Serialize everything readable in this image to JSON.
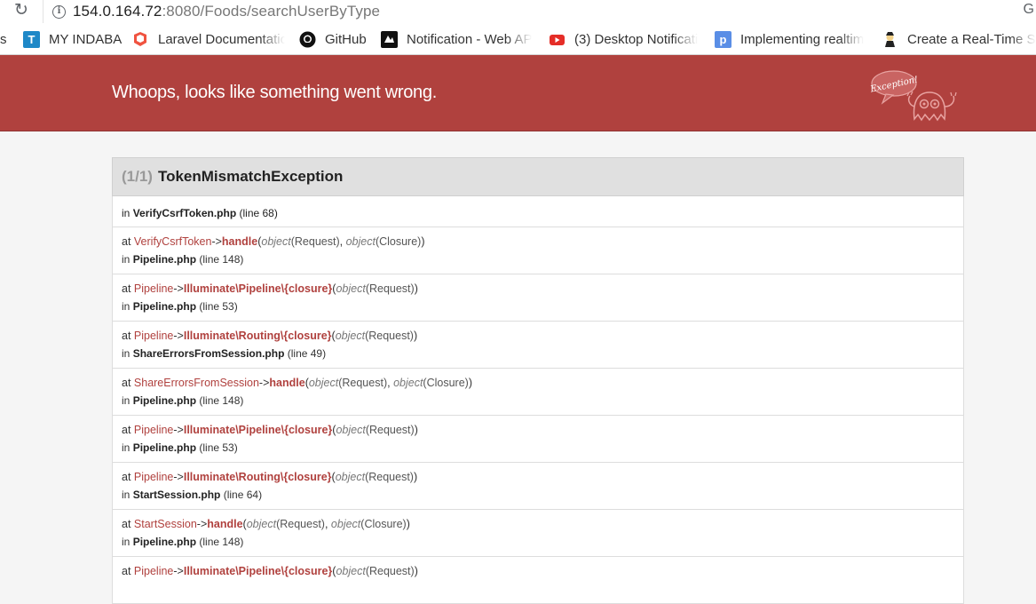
{
  "browser": {
    "url_host": "154.0.164.72",
    "url_path": ":8080/Foods/searchUserByType",
    "bookmarks": [
      {
        "label": "s",
        "icon": "bookmark-partial-icon"
      },
      {
        "label": "MY INDABA",
        "icon": "t-logo-icon"
      },
      {
        "label": "Laravel Documentatio",
        "icon": "laravel-icon"
      },
      {
        "label": "GitHub",
        "icon": "github-icon"
      },
      {
        "label": "Notification - Web AP",
        "icon": "mdn-icon"
      },
      {
        "label": "(3) Desktop Notificati",
        "icon": "youtube-icon"
      },
      {
        "label": "Implementing realtim",
        "icon": "p-logo-icon"
      },
      {
        "label": "Create a Real-Time Sh",
        "icon": "dev-avatar-icon"
      }
    ]
  },
  "header": {
    "title": "Whoops, looks like something went wrong.",
    "logo_text": "Exception!"
  },
  "exception": {
    "count": "(1/1)",
    "name": "TokenMismatchException",
    "first": {
      "prefix": "in",
      "file": "VerifyCsrfToken.php",
      "line": "(line 68)"
    },
    "frames": [
      {
        "cls": "VerifyCsrfToken",
        "fn": "handle",
        "args": [
          [
            "object",
            "Request"
          ],
          [
            "object",
            "Closure"
          ]
        ],
        "file": "Pipeline.php",
        "line": "(line 148)"
      },
      {
        "cls": "Pipeline",
        "fn": "Illuminate\\Pipeline\\{closure}",
        "args": [
          [
            "object",
            "Request"
          ]
        ],
        "file": "Pipeline.php",
        "line": "(line 53)"
      },
      {
        "cls": "Pipeline",
        "fn": "Illuminate\\Routing\\{closure}",
        "args": [
          [
            "object",
            "Request"
          ]
        ],
        "file": "ShareErrorsFromSession.php",
        "line": "(line 49)"
      },
      {
        "cls": "ShareErrorsFromSession",
        "fn": "handle",
        "args": [
          [
            "object",
            "Request"
          ],
          [
            "object",
            "Closure"
          ]
        ],
        "file": "Pipeline.php",
        "line": "(line 148)"
      },
      {
        "cls": "Pipeline",
        "fn": "Illuminate\\Pipeline\\{closure}",
        "args": [
          [
            "object",
            "Request"
          ]
        ],
        "file": "Pipeline.php",
        "line": "(line 53)"
      },
      {
        "cls": "Pipeline",
        "fn": "Illuminate\\Routing\\{closure}",
        "args": [
          [
            "object",
            "Request"
          ]
        ],
        "file": "StartSession.php",
        "line": "(line 64)"
      },
      {
        "cls": "StartSession",
        "fn": "handle",
        "args": [
          [
            "object",
            "Request"
          ],
          [
            "object",
            "Closure"
          ]
        ],
        "file": "Pipeline.php",
        "line": "(line 148)"
      },
      {
        "cls": "Pipeline",
        "fn": "Illuminate\\Pipeline\\{closure}",
        "args": [
          [
            "object",
            "Request"
          ]
        ],
        "file": "",
        "line": ""
      }
    ]
  },
  "labels": {
    "at": "at",
    "in": "in",
    "arrow": "->"
  },
  "colors": {
    "header_bg": "#b0413e",
    "accent": "#b0413e"
  }
}
